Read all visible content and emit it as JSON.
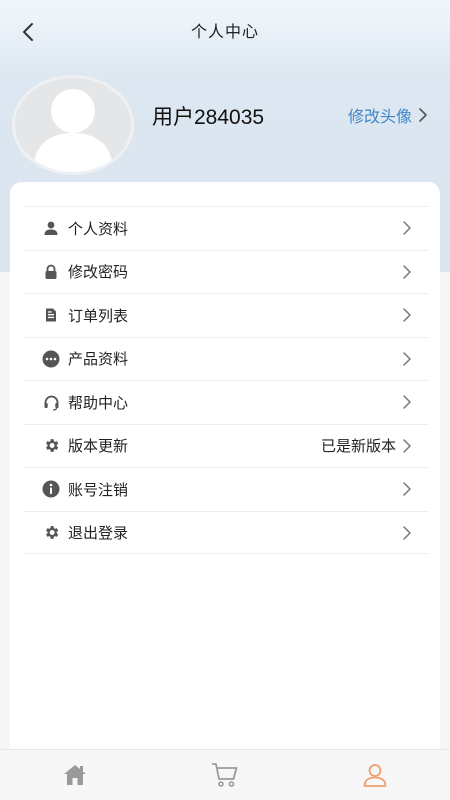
{
  "header": {
    "title": "个人中心"
  },
  "profile": {
    "username": "用户284035",
    "change_avatar_label": "修改头像"
  },
  "menu": {
    "items": [
      {
        "label": "个人资料",
        "icon": "person-icon",
        "value": ""
      },
      {
        "label": "修改密码",
        "icon": "lock-icon",
        "value": ""
      },
      {
        "label": "订单列表",
        "icon": "document-icon",
        "value": ""
      },
      {
        "label": "产品资料",
        "icon": "more-dots-icon",
        "value": ""
      },
      {
        "label": "帮助中心",
        "icon": "headset-icon",
        "value": ""
      },
      {
        "label": "版本更新",
        "icon": "gear-icon",
        "value": "已是新版本"
      },
      {
        "label": "账号注销",
        "icon": "info-icon",
        "value": ""
      },
      {
        "label": "退出登录",
        "icon": "gear-icon",
        "value": ""
      }
    ]
  },
  "tabbar": {
    "tabs": [
      {
        "icon": "home-icon",
        "active": false
      },
      {
        "icon": "cart-icon",
        "active": false
      },
      {
        "icon": "user-icon",
        "active": true
      }
    ]
  },
  "colors": {
    "accent": "#3f86c8",
    "active_tab": "#f0a070",
    "inactive_tab": "#9a9a9a",
    "icon": "#555555"
  }
}
